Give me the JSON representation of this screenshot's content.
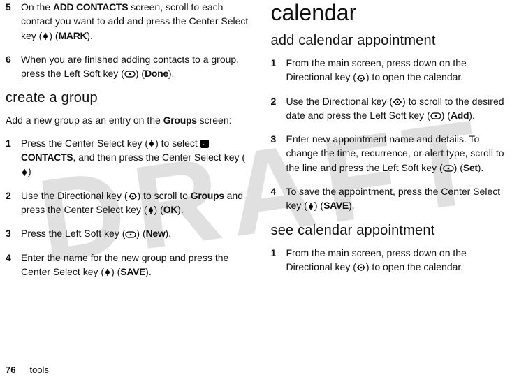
{
  "watermark": "DRAFT",
  "footer": {
    "pageNumber": "76",
    "section": "tools"
  },
  "left": {
    "steps1": [
      {
        "n": "5",
        "pre": "On the ",
        "b1": "ADD CONTACTS",
        "mid1": " screen, scroll to each contact you want to add and press the Center Select key (",
        "key1": "s",
        "mid2": ") (",
        "b2": "MARK",
        "post": ")."
      },
      {
        "n": "6",
        "pre": "When you are finished adding contacts to a group, press the Left Soft key (",
        "key1": "soft",
        "mid2": ") (",
        "b2": "Done",
        "post": ")."
      }
    ],
    "heading": "create a group",
    "intro_a": "Add a new group as an entry on the ",
    "intro_b": "Groups",
    "intro_c": " screen:",
    "steps2": [
      {
        "n": "1",
        "pre": "Press the Center Select key (",
        "key1": "s",
        "mid1": ") to select ",
        "icon": "phone",
        "b1": "CONTACTS",
        "mid2": ", and then press the Center Select key (",
        "key2": "s",
        "post": ")"
      },
      {
        "n": "2",
        "pre": "Use the Directional key (",
        "key1": "S",
        "mid1": ") to scroll to ",
        "b1": "Groups",
        "mid2": " and press the Center Select key (",
        "key2": "s",
        "mid3": ") (",
        "b2": "OK",
        "post": ")."
      },
      {
        "n": "3",
        "pre": "Press the Left Soft key (",
        "key1": "soft",
        "mid2": ") (",
        "b2": "New",
        "post": ")."
      },
      {
        "n": "4",
        "pre": "Enter the name for the new group and press the Center Select key (",
        "key1": "s",
        "mid2": ") (",
        "b2": "SAVE",
        "post": ")."
      }
    ]
  },
  "right": {
    "title": "calendar",
    "heading1": "add calendar appointment",
    "steps1": [
      {
        "n": "1",
        "pre": "From the main screen, press down on the Directional key (",
        "key1": "S",
        "post": ") to open the calendar."
      },
      {
        "n": "2",
        "pre": "Use the Directional key (",
        "key1": "S",
        "mid1": ") to scroll to the desired date and press the Left Soft key (",
        "key2": "soft",
        "mid3": ") (",
        "b2": "Add",
        "post": ")."
      },
      {
        "n": "3",
        "pre": "Enter new appointment name and details. To change the time, recurrence, or alert type, scroll to the line and press the Left Soft key (",
        "key1": "soft",
        "mid2": ") (",
        "b2": "Set",
        "post": ")."
      },
      {
        "n": "4",
        "pre": "To save the appointment, press the Center Select key (",
        "key1": "s",
        "mid2": ") (",
        "b2": "SAVE",
        "post": ")."
      }
    ],
    "heading2": "see calendar appointment",
    "steps2": [
      {
        "n": "1",
        "pre": "From the main screen, press down on the Directional key (",
        "key1": "S",
        "post": ") to open the calendar."
      }
    ]
  }
}
